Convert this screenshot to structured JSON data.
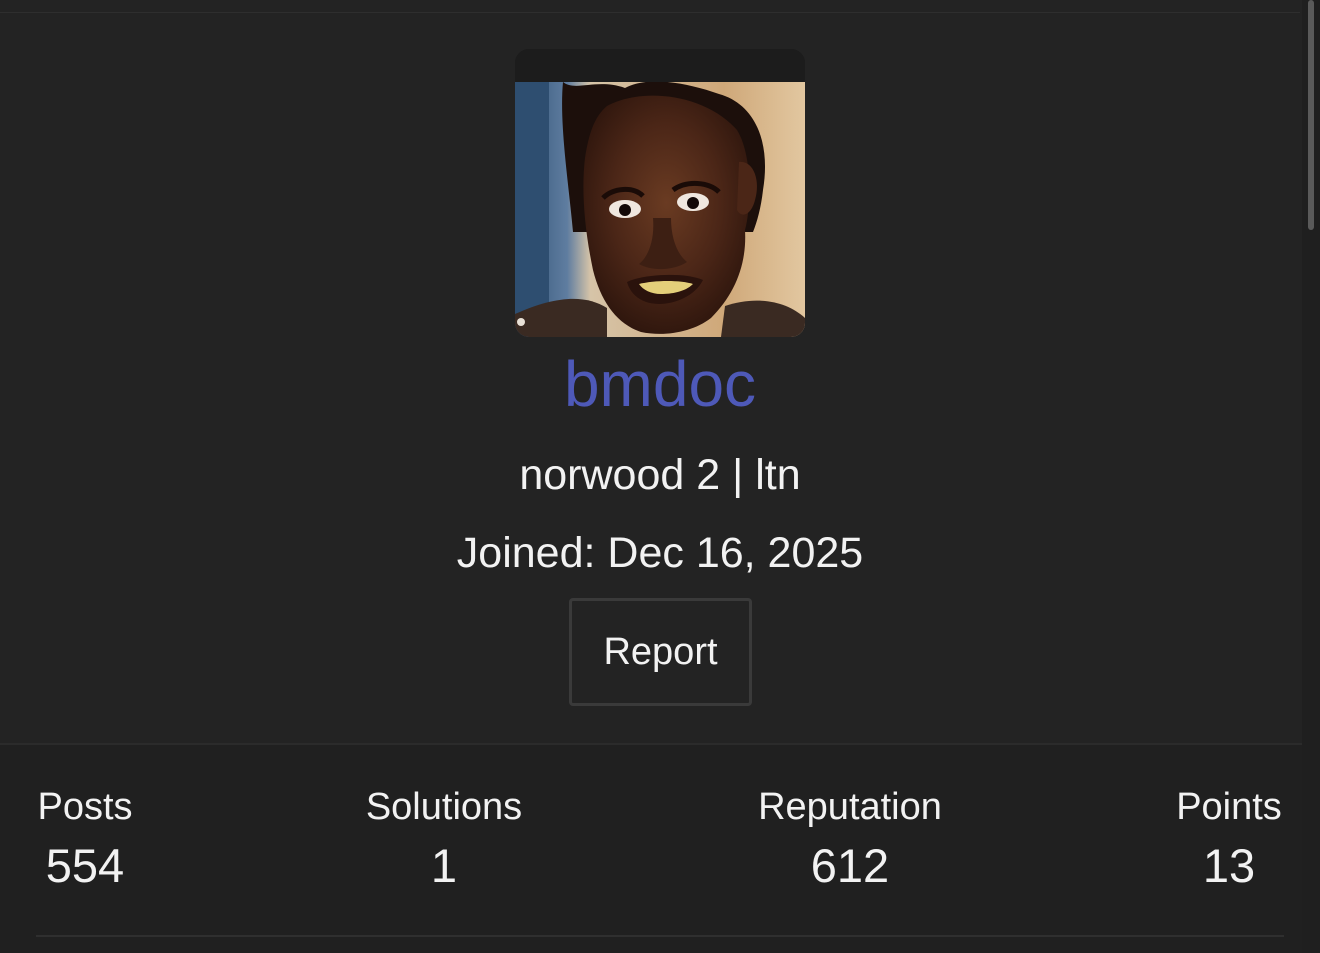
{
  "profile": {
    "username": "bmdoc",
    "title": "norwood 2 | ltn",
    "joined_label": "Joined: ",
    "joined_date": "Dec 16, 2025",
    "report_label": "Report",
    "avatar_alt": "bmdoc avatar"
  },
  "stats": [
    {
      "label": "Posts",
      "value": "554"
    },
    {
      "label": "Solutions",
      "value": "1"
    },
    {
      "label": "Reputation",
      "value": "612"
    },
    {
      "label": "Points",
      "value": "13"
    }
  ],
  "colors": {
    "background": "#232323",
    "username": "#4e59b8",
    "text": "#f2f2f2",
    "stats_background": "#202020"
  }
}
